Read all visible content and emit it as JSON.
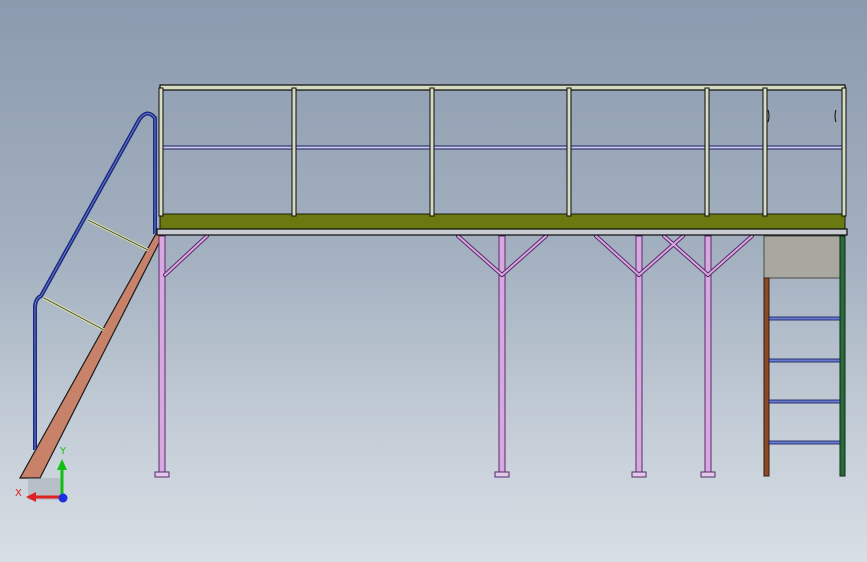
{
  "viewport": {
    "background_top": "#8b9aae",
    "background_bottom": "#d8dee5"
  },
  "model": {
    "components": [
      "guardrail",
      "platform-deck",
      "support-column",
      "diagonal-brace",
      "stair-stringer",
      "stair-handrail",
      "access-ladder"
    ]
  },
  "colors": {
    "rail_outline": "#0a0a0a",
    "rail_fill": "#d6dcc0",
    "mid_rail": "#3a3ab0",
    "deck": "#6a7a10",
    "column": "#a050b8",
    "stringer": "#c8826a",
    "handrail": "#1a2a80",
    "ladder_frame_left": "#8a4a2a",
    "ladder_frame_right": "#2a6a3a",
    "ladder_rung": "#2a3ab0",
    "ladder_panel": "#a8a8a0"
  },
  "triad": {
    "x_label": "X",
    "y_label": "Y",
    "x_color": "#e02020",
    "y_color": "#10c010",
    "z_color": "#1a30e0"
  }
}
